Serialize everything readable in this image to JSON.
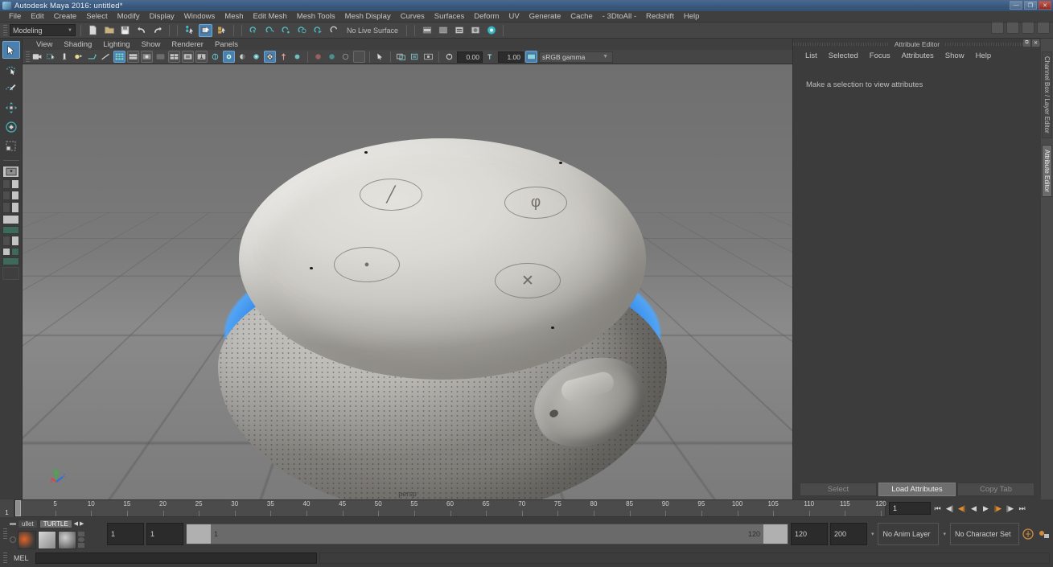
{
  "window": {
    "title": "Autodesk Maya 2016: untitled*",
    "app_icon": "maya-icon",
    "buttons": [
      {
        "name": "minimize-button",
        "glyph": "—"
      },
      {
        "name": "maximize-button",
        "glyph": "❐"
      },
      {
        "name": "close-button",
        "glyph": "✕"
      }
    ]
  },
  "menubar": {
    "items": [
      "File",
      "Edit",
      "Create",
      "Select",
      "Modify",
      "Display",
      "Windows",
      "Mesh",
      "Edit Mesh",
      "Mesh Tools",
      "Mesh Display",
      "Curves",
      "Surfaces",
      "Deform",
      "UV",
      "Generate",
      "Cache",
      "- 3DtoAll -",
      "Redshift",
      "Help"
    ]
  },
  "statusline": {
    "menuset": "Modeling",
    "live_surface": "No Live Surface",
    "icons": [
      "new-scene-icon",
      "open-scene-icon",
      "save-scene-icon",
      "undo-icon",
      "redo-icon",
      "select-by-hierarchy-icon",
      "select-by-object-icon",
      "select-by-component-icon",
      "snap-to-grid-icon",
      "snap-to-curve-icon",
      "snap-to-point-icon",
      "snap-to-projected-center-icon",
      "snap-to-view-plane-icon",
      "make-live-icon",
      "render-current-frame-icon",
      "ipr-render-icon",
      "render-settings-icon",
      "hypershade-icon",
      "render-view-icon"
    ]
  },
  "workspace_icons": [
    "channel-box-toggle-icon",
    "layer-editor-toggle-icon",
    "attribute-editor-toggle-icon",
    "workspace-selector-icon"
  ],
  "toolbox": {
    "tools": [
      {
        "name": "select-tool",
        "selected": true
      },
      {
        "name": "lasso-select-tool",
        "selected": false
      },
      {
        "name": "paint-select-tool",
        "selected": false
      },
      {
        "name": "move-tool",
        "selected": false
      },
      {
        "name": "rotate-tool",
        "selected": false
      },
      {
        "name": "scale-tool",
        "selected": false
      }
    ],
    "layout_presets": [
      "single-pane-layout",
      "four-pane-layout",
      "two-pane-side-layout",
      "persp-outliner-layout",
      "persp-graph-layout",
      "hypershade-layout",
      "outliner-persp-layout",
      "persp-uv-layout",
      "single-perspective-layout"
    ]
  },
  "viewport": {
    "menu": [
      "View",
      "Shading",
      "Lighting",
      "Show",
      "Renderer",
      "Panels"
    ],
    "label": "persp",
    "exposure": "0.00",
    "gamma": "1.00",
    "color_profile": "sRGB gamma",
    "toolbar_icons": [
      "camera-attributes-icon",
      "bookmark-icon",
      "image-plane-icon",
      "two-sided-lighting-icon",
      "shadows-icon",
      "ao-icon",
      "wireframe-shading-icon",
      "smooth-shade-all-icon",
      "smooth-shade-textured-icon",
      "flat-shade-icon",
      "wireframe-on-shaded-icon",
      "xray-icon",
      "xray-joints-icon",
      "default-light-icon",
      "all-lights-icon",
      "shadow-icon",
      "ao-toggle-icon",
      "motion-blur-icon",
      "multisample-icon",
      "depth-peeling-icon",
      "grid-toggle-icon",
      "film-gate-icon",
      "resolution-gate-icon",
      "gate-mask-icon",
      "exposure-icon",
      "gamma-icon",
      "color-management-icon"
    ],
    "model": {
      "name": "amazon-echo-dot-3rd-gen",
      "buttons": [
        {
          "name": "volume-down-button",
          "glyph": "╱"
        },
        {
          "name": "microphone-off-button",
          "glyph": "φ"
        },
        {
          "name": "action-button",
          "glyph": "●"
        },
        {
          "name": "volume-up-button",
          "glyph": "✕"
        }
      ],
      "light_ring_color": "#3f93ec",
      "body_color": "#b9b7b2",
      "top_color": "#dbd9d3"
    }
  },
  "attribute_editor": {
    "title": "Attribute Editor",
    "menu": [
      "List",
      "Selected",
      "Focus",
      "Attributes",
      "Show",
      "Help"
    ],
    "hint": "Make a selection to view attributes",
    "buttons": [
      {
        "label": "Select",
        "active": false
      },
      {
        "label": "Load Attributes",
        "active": true
      },
      {
        "label": "Copy Tab",
        "active": false
      }
    ],
    "dock_buttons": [
      {
        "name": "undock-panel-button",
        "glyph": "⧉"
      },
      {
        "name": "close-panel-button",
        "glyph": "✕"
      }
    ]
  },
  "side_tabs": [
    {
      "label": "Channel Box / Layer Editor",
      "active": false
    },
    {
      "label": "Attribute Editor",
      "active": true
    }
  ],
  "timeline": {
    "start_label": "1",
    "ticks": [
      5,
      10,
      15,
      20,
      25,
      30,
      35,
      40,
      45,
      50,
      55,
      60,
      65,
      70,
      75,
      80,
      85,
      90,
      95,
      100,
      105,
      110,
      115,
      120
    ],
    "current_frame": "1",
    "playback_controls": [
      {
        "name": "go-to-start-button",
        "glyph": "⏮"
      },
      {
        "name": "step-back-keyframe-button",
        "glyph": "◀|"
      },
      {
        "name": "step-back-frame-button",
        "glyph": "◀|"
      },
      {
        "name": "play-backwards-button",
        "glyph": "◀"
      },
      {
        "name": "play-forwards-button",
        "glyph": "▶"
      },
      {
        "name": "step-forward-frame-button",
        "glyph": "|▶"
      },
      {
        "name": "step-forward-keyframe-button",
        "glyph": "|▶"
      },
      {
        "name": "go-to-end-button",
        "glyph": "⏭"
      }
    ]
  },
  "range_slider": {
    "anim_start": "1",
    "playback_start": "1",
    "range_start_label": "1",
    "range_end_label": "120",
    "playback_end": "120",
    "anim_end": "200",
    "anim_layer": "No Anim Layer",
    "character_set": "No Character Set",
    "extra_icons": [
      "auto-keyframe-icon",
      "animation-preferences-icon"
    ]
  },
  "shelf": {
    "tabs": [
      {
        "label": "ullet",
        "active": false
      },
      {
        "label": "TURTLE",
        "active": true
      }
    ],
    "nav": [
      {
        "name": "shelf-prev-button",
        "glyph": "◀"
      },
      {
        "name": "shelf-next-button",
        "glyph": "▶"
      }
    ],
    "icons": [
      "turtle-render-icon",
      "turtle-bake-icon",
      "turtle-material-icon"
    ]
  },
  "command_line": {
    "language": "MEL",
    "input_value": "",
    "output_value": ""
  }
}
